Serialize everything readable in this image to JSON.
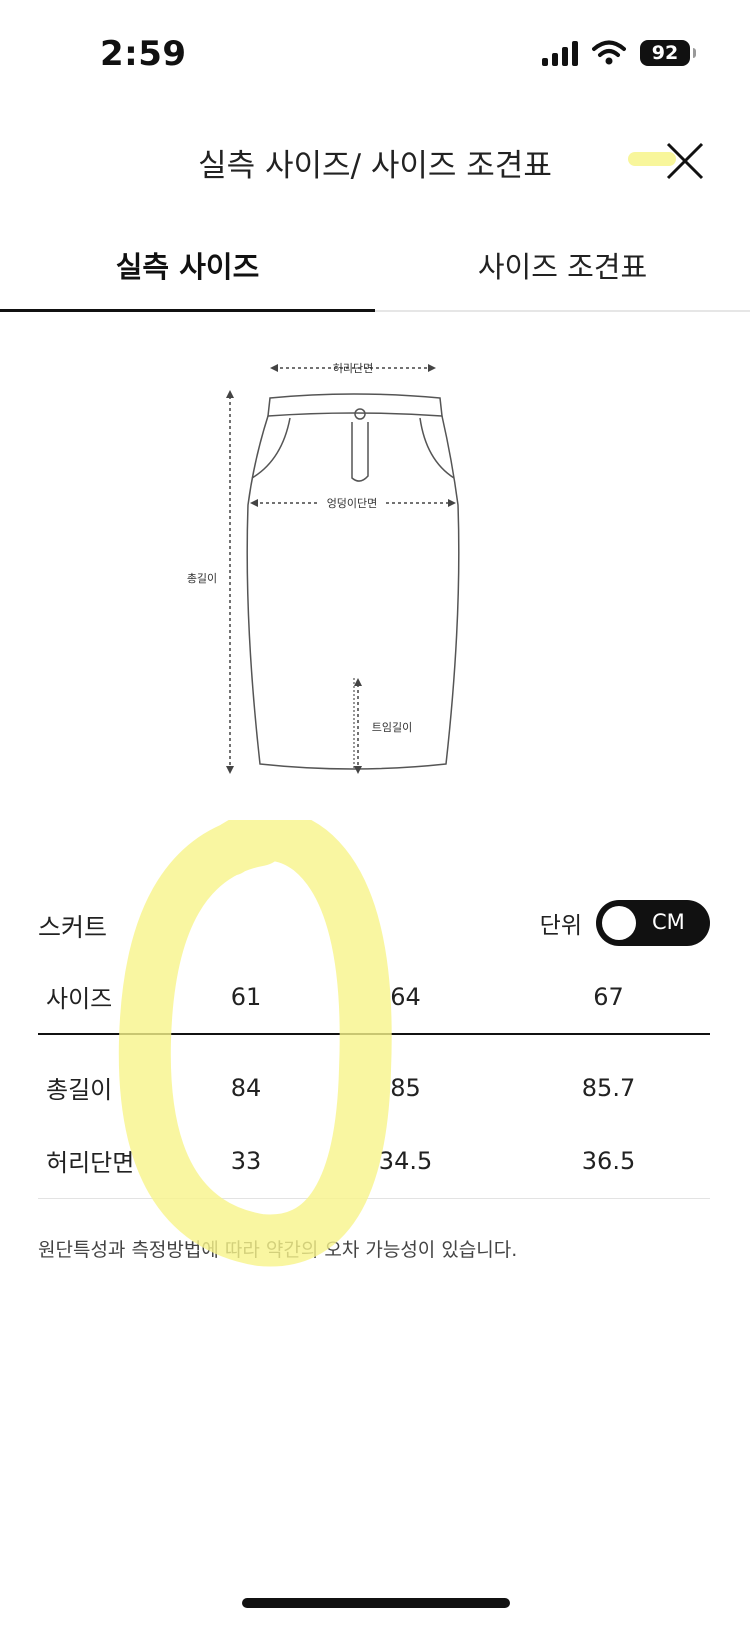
{
  "status": {
    "time": "2:59",
    "battery": "92"
  },
  "header": {
    "title": "실측 사이즈/ 사이즈 조견표"
  },
  "tabs": [
    {
      "label": "실측 사이즈",
      "active": true
    },
    {
      "label": "사이즈 조견표",
      "active": false
    }
  ],
  "diagram": {
    "waist_label": "허리단면",
    "hip_label": "엉덩이단면",
    "length_label": "총길이",
    "slit_label": "트임길이"
  },
  "section": {
    "title": "스커트",
    "unit_label": "단위",
    "unit_value": "CM"
  },
  "table": {
    "header": [
      "사이즈",
      "61",
      "64",
      "67"
    ],
    "rows": [
      [
        "총길이",
        "84",
        "85",
        "85.7"
      ],
      [
        "허리단면",
        "33",
        "34.5",
        "36.5"
      ]
    ]
  },
  "note": "원단특성과 측정방법에 따라 약간의 오차 가능성이 있습니다.",
  "colors": {
    "highlighter": "#f7f48a",
    "toggle": "#111111"
  }
}
